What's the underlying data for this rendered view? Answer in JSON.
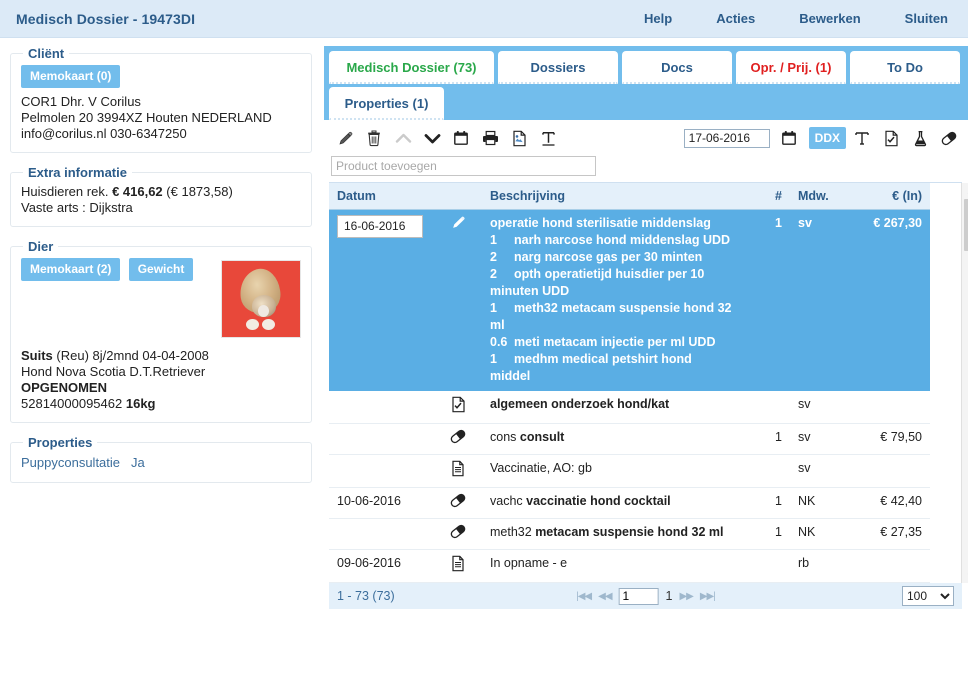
{
  "window": {
    "title": "Medisch Dossier - 19473DI",
    "menu": [
      {
        "label": "Help",
        "name": "menu-help"
      },
      {
        "label": "Acties",
        "name": "menu-acties"
      },
      {
        "label": "Bewerken",
        "name": "menu-bewerken"
      },
      {
        "label": "Sluiten",
        "name": "menu-sluiten"
      }
    ]
  },
  "client": {
    "legend": "Cliënt",
    "memokaart_button": "Memokaart (0)",
    "name_line": "COR1 Dhr. V Corilus",
    "address_line": "Pelmolen 20 3994XZ Houten NEDERLAND",
    "contact_line": "info@corilus.nl 030-6347250"
  },
  "extra": {
    "legend": "Extra informatie",
    "account_label": "Huisdieren rek.",
    "account_value": "€ 416,62",
    "account_total": "(€ 1873,58)",
    "vet_label": "Vaste arts :",
    "vet_value": "Dijkstra"
  },
  "animal": {
    "legend": "Dier",
    "memokaart_button": "Memokaart (2)",
    "gewicht_button": "Gewicht",
    "name": "Suits",
    "sex_age": "(Reu) 8j/2mnd 04-04-2008",
    "breed": "Hond Nova Scotia D.T.Retriever",
    "status": "OPGENOMEN",
    "chip": "52814000095462",
    "weight": "16kg"
  },
  "properties_panel": {
    "legend": "Properties",
    "rows": [
      {
        "key": "Puppyconsultatie",
        "value": "Ja"
      }
    ]
  },
  "tabs": {
    "row1": [
      {
        "label": "Medisch Dossier (73)",
        "state": "active",
        "width": "w1"
      },
      {
        "label": "Dossiers",
        "state": "normal",
        "width": "w2"
      },
      {
        "label": "Docs",
        "state": "normal",
        "width": "w3"
      },
      {
        "label": "Opr. / Prij. (1)",
        "state": "alert",
        "width": "w4"
      },
      {
        "label": "To Do",
        "state": "normal",
        "width": "w5"
      }
    ],
    "row2": [
      {
        "label": "Properties (1)",
        "state": "normal"
      }
    ]
  },
  "toolbar": {
    "icons": [
      {
        "name": "edit-pencil-icon",
        "glyph": "pencil",
        "disabled": false
      },
      {
        "name": "delete-trash-icon",
        "glyph": "trash",
        "disabled": false
      },
      {
        "name": "move-up-chevron-icon",
        "glyph": "chevron-up",
        "disabled": true
      },
      {
        "name": "move-down-chevron-icon",
        "glyph": "chevron-down",
        "disabled": false
      },
      {
        "name": "calendar-icon",
        "glyph": "calendar",
        "disabled": false
      },
      {
        "name": "print-icon",
        "glyph": "printer",
        "disabled": false
      },
      {
        "name": "document-image-icon",
        "glyph": "doc-image",
        "disabled": false
      },
      {
        "name": "text-format-icon",
        "glyph": "text-T",
        "disabled": false
      }
    ],
    "date_value": "17-06-2016",
    "date_picker_icon": "calendar-icon",
    "ddx_label": "DDX",
    "right_icons": [
      {
        "name": "text-tool-icon",
        "glyph": "serif-T"
      },
      {
        "name": "checklist-document-icon",
        "glyph": "doc-check"
      },
      {
        "name": "lab-flask-icon",
        "glyph": "flask"
      },
      {
        "name": "medication-pill-icon",
        "glyph": "pill"
      }
    ]
  },
  "search": {
    "placeholder": "Product toevoegen",
    "value": ""
  },
  "grid": {
    "columns": [
      "Datum",
      "",
      "Beschrijving",
      "#",
      "Mdw.",
      "€ (In)"
    ],
    "rows": [
      {
        "date": "16-06-2016",
        "icon": "pencil",
        "selected": true,
        "description_main": "operatie hond sterilisatie middenslag",
        "description_lines": [
          {
            "qty": "1",
            "code": "narh",
            "text": "narcose hond middenslag UDD"
          },
          {
            "qty": "2",
            "code": "narg",
            "text": "narcose gas per 30 minten"
          },
          {
            "qty": "2",
            "code": "opth",
            "text": "operatietijd huisdier per 10 minuten UDD"
          },
          {
            "qty": "1",
            "code": "meth32",
            "text": "metacam suspensie hond 32 ml"
          },
          {
            "qty": "0.6",
            "code": "meti",
            "text": "metacam injectie per ml UDD"
          },
          {
            "qty": "1",
            "code": "medhm",
            "text": "medical petshirt hond middel"
          }
        ],
        "qty": "1",
        "mdw": "sv",
        "amount": "€ 267,30"
      },
      {
        "date": "",
        "icon": "doc-check",
        "selected": false,
        "description_main": "algemeen onderzoek hond/kat",
        "description_lines": [],
        "qty": "",
        "mdw": "sv",
        "amount": ""
      },
      {
        "date": "",
        "icon": "pill",
        "selected": false,
        "description_code": "cons",
        "description_main": "consult",
        "description_lines": [],
        "qty": "1",
        "mdw": "sv",
        "amount": "€ 79,50"
      },
      {
        "date": "",
        "icon": "doc",
        "selected": false,
        "description_plain": "Vaccinatie, AO: gb",
        "description_lines": [],
        "qty": "",
        "mdw": "sv",
        "amount": ""
      },
      {
        "date": "10-06-2016",
        "icon": "pill",
        "selected": false,
        "description_code": "vachc",
        "description_main": "vaccinatie hond cocktail",
        "description_lines": [],
        "qty": "1",
        "mdw": "NK",
        "amount": "€ 42,40"
      },
      {
        "date": "",
        "icon": "pill",
        "selected": false,
        "description_code": "meth32",
        "description_main": "metacam suspensie hond 32 ml",
        "description_lines": [],
        "qty": "1",
        "mdw": "NK",
        "amount": "€ 27,35"
      },
      {
        "date": "09-06-2016",
        "icon": "doc",
        "selected": false,
        "description_plain": "In opname - e",
        "description_lines": [],
        "qty": "",
        "mdw": "rb",
        "amount": ""
      }
    ]
  },
  "pager": {
    "range": "1 - 73 (73)",
    "first_icon": "first-page-icon",
    "prev_icon": "previous-page-icon",
    "page_value": "1",
    "total_pages": "1",
    "next_icon": "next-page-icon",
    "last_icon": "last-page-icon",
    "page_size": "100",
    "page_size_options": [
      "100"
    ]
  },
  "colors": {
    "accent": "#72bdec",
    "selection": "#5aaee4",
    "title_text": "#2c5c8a",
    "header_bg": "#e4f0fa",
    "active_tab_text": "#2aa84a",
    "alert_tab_text": "#e02020"
  }
}
